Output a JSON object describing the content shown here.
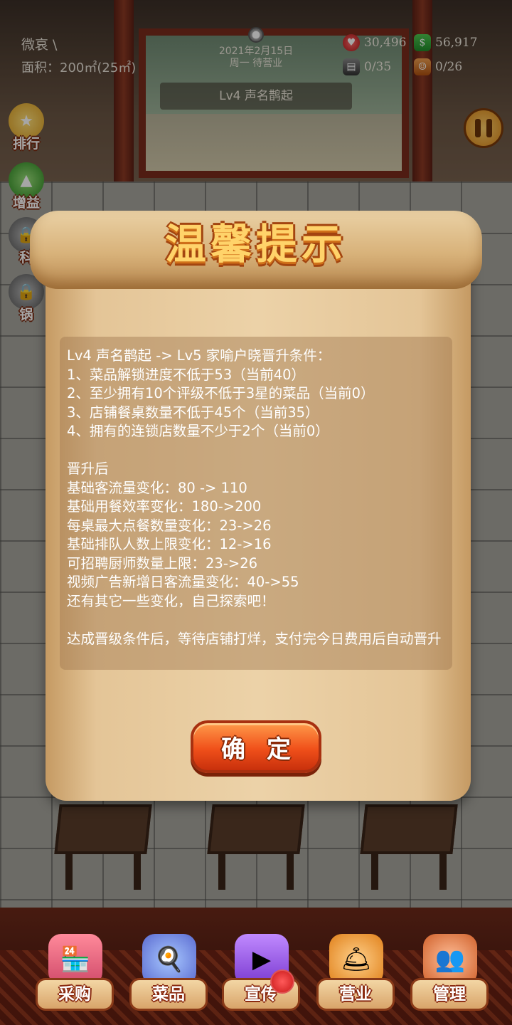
{
  "hud": {
    "player_name": "微哀 \\",
    "area": "面积：200㎡(25㎡)",
    "date": "2021年2月15日",
    "weekday_status": "周一  待营业",
    "level": "Lv4 声名鹊起",
    "hearts": "30,496",
    "cash": "56,917",
    "tables": "0/35",
    "chefs": "0/26"
  },
  "side_buttons": [
    "排行",
    "增益",
    "科",
    "锅"
  ],
  "dialog": {
    "title": "温馨提示",
    "lines": [
      "Lv4 声名鹊起 -> Lv5 家喻户晓晋升条件：",
      "1、菜品解锁进度不低于53（当前40）",
      "2、至少拥有10个评级不低于3星的菜品（当前0）",
      "3、店铺餐桌数量不低于45个（当前35）",
      "4、拥有的连锁店数量不少于2个（当前0）",
      "晋升后",
      "基础客流量变化：80 -> 110",
      "基础用餐效率变化：180->200",
      "每桌最大点餐数量变化：23->26",
      "基础排队人数上限变化：12->16",
      "可招聘厨师数量上限：23->26",
      "视频广告新增日客流量变化：40->55",
      "还有其它一些变化，自己探索吧！",
      "达成晋级条件后，等待店铺打烊，支付完今日费用后自动晋升"
    ],
    "confirm_label": "确定"
  },
  "nav": [
    "采购",
    "菜品",
    "宣传",
    "营业",
    "管理"
  ],
  "colors": {
    "accent_orange": "#f0501a",
    "scroll_paper": "#ecd2a8",
    "title_gold": "#ffd36a"
  },
  "icons": {
    "stats": [
      "heart-icon",
      "cash-icon",
      "table-icon",
      "chef-icon"
    ],
    "nav": [
      "market-icon",
      "dish-icon",
      "video-icon",
      "cloche-icon",
      "staff-icon"
    ]
  }
}
